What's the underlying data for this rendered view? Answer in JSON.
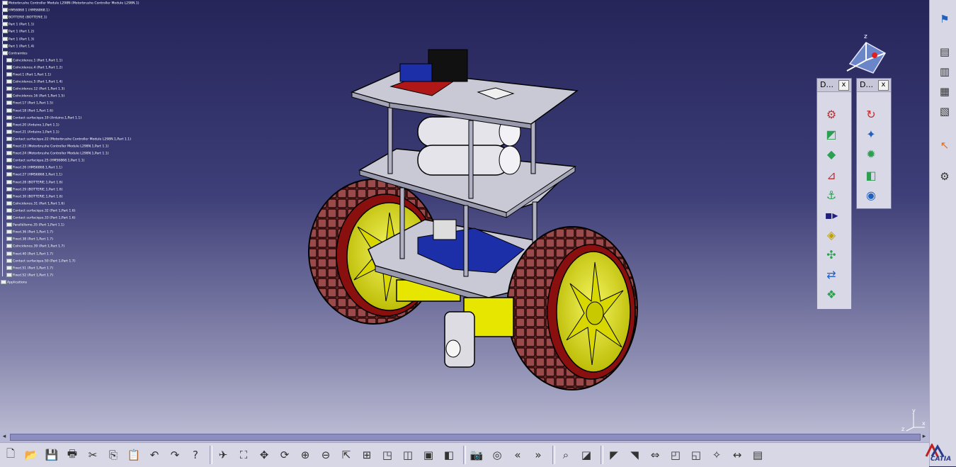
{
  "tree": {
    "nodes": [
      "Motorbrushe Controller Module L298N (Motorbrushe Controller Module L298N.1)",
      "HMS6868 1 (HMS6868.1)",
      "BOTTERIE (BOTTERIE.1)",
      "Part 1 (Part 1.1)",
      "Part 1 (Part 1.2)",
      "Part 1 (Part 1.3)",
      "Part 1 (Part 1.4)",
      "Contraintes",
      "Coïncidence.1 (Part 1,Part 1.1)",
      "Coïncidence.4 (Part 1,Part 1.2)",
      "Fixed.1 (Part 1,Part 1.1)",
      "Coïncidence.5 (Part 1,Part 1.4)",
      "Coïncidence.12 (Part 1,Part 1.3)",
      "Coïncidence.16 (Part 1,Part 1.5)",
      "Fixed.17 (Part 1,Part 1.5)",
      "Fixed.18 (Part 1,Part 1.6)",
      "Contact surfacique.19 (Arduino.1,Part 1.1)",
      "Fixed.20 (Arduino.1,Part 1.1)",
      "Fixed.21 (Arduino.1,Part 1.1)",
      "Contact surfacique.22 (Motorbrushe Controller Module L298N.1,Part 1.1)",
      "Fixed.23 (Motorbrushe Controller Module L298N.1,Part 1.1)",
      "Fixed.24 (Motorbrushe Controller Module L298N.1,Part 1.1)",
      "Contact surfacique.25 (HMS6868.1,Part 1.1)",
      "Fixed.26 (HMS6868.1,Part 1.1)",
      "Fixed.27 (HMS6868.1,Part 1.1)",
      "Fixed.28 (BOTTERIE.1,Part 1.6)",
      "Fixed.29 (BOTTERIE.1,Part 1.6)",
      "Fixed.30 (BOTTERIE.1,Part 1.6)",
      "Coïncidence.31 (Part 1,Part 1.6)",
      "Contact surfacique.32 (Part 1,Part 1.6)",
      "Contact surfacique.33 (Part 1,Part 1.6)",
      "Parallélisme.35 (Part 1,Part 1.1)",
      "Fixed.36 (Part 1,Part 1.7)",
      "Fixed.38 (Part 1,Part 1.7)",
      "Coïncidence.39 (Part 1,Part 1.7)",
      "Fixed.40 (Part 1,Part 1.7)",
      "Contact surfacique.50 (Part 1,Part 1.7)",
      "Fixed.51 (Part 1,Part 1.7)",
      "Fixed.52 (Part 1,Part 1.7)",
      "Applications"
    ]
  },
  "panels": [
    {
      "title": "D...",
      "close": "x"
    },
    {
      "title": "D...",
      "close": "x"
    }
  ],
  "toolbar": {
    "buttons": [
      "new-icon",
      "open-icon",
      "save-icon",
      "print-icon",
      "cut-icon",
      "copy-icon",
      "paste-icon",
      "undo-icon",
      "redo-icon",
      "whats-this-icon",
      "fly-mode-icon",
      "fit-all-icon",
      "pan-icon",
      "rotate-icon",
      "zoom-in-icon",
      "zoom-out-icon",
      "normal-view-icon",
      "multi-view-icon",
      "iso-view-icon",
      "hide-show-icon",
      "swap-visible-icon",
      "render-style-icon",
      "measure-icon",
      "previous-icon",
      "next-icon",
      "clash-icon",
      "capture-icon",
      "reframe-icon",
      "first-icon",
      "last-icon",
      "zoom-area-icon",
      "section-icon",
      "shading-icon",
      "lighting-icon",
      "measure-between-icon",
      "analysis-icon"
    ]
  },
  "axes": {
    "x": "x",
    "y": "y",
    "z": "z"
  },
  "branding": {
    "logo_text": "CATIA"
  },
  "colors": {
    "background_top": "#25255a",
    "background_bottom": "#b9b9d2",
    "tire": "#7a2e2e",
    "rim": "#e6e600",
    "plate": "#c9c9d6",
    "board": "#1c2ea8"
  }
}
